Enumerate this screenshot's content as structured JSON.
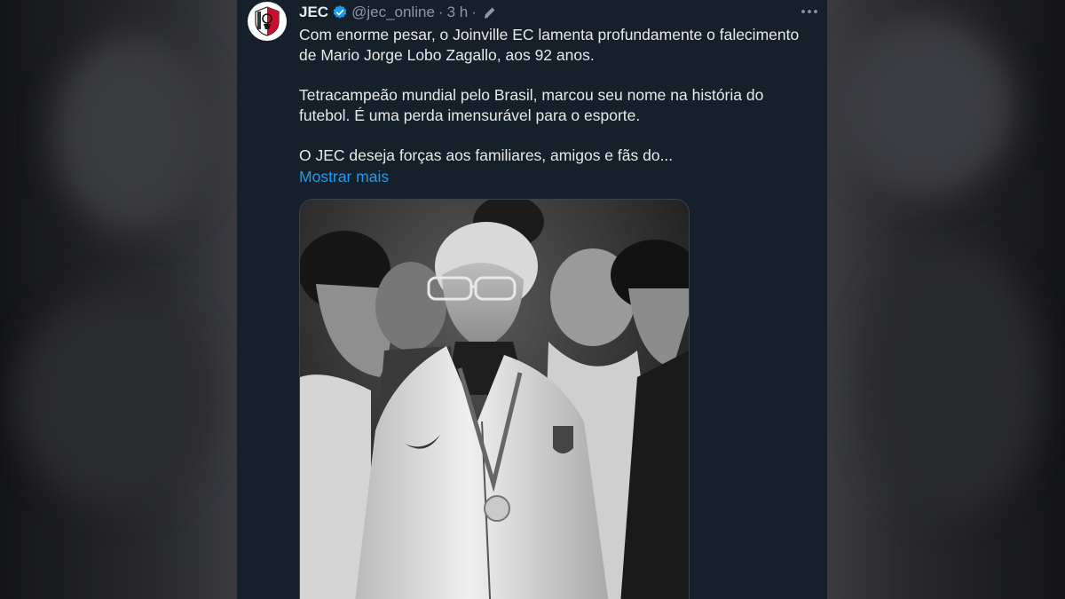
{
  "tweet": {
    "author_name": "JEC",
    "handle": "@jec_online",
    "separator": "·",
    "time": "3 h",
    "separator2": "·",
    "paragraphs": [
      "Com enorme pesar, o Joinville EC lamenta profundamente o falecimento de Mario Jorge Lobo Zagallo, aos 92 anos.",
      "Tetracampeão mundial pelo Brasil, marcou seu nome na história do futebol. É uma perda imensurável para o esporte.",
      "O JEC deseja forças aos familiares, amigos e fãs do..."
    ],
    "show_more": "Mostrar mais"
  },
  "colors": {
    "panel_bg": "#15202b",
    "text": "#e7e9ea",
    "muted": "#8b98a5",
    "link": "#1d9bf0",
    "verified": "#1d9bf0",
    "club_red": "#c8102e"
  },
  "icons": {
    "verified": "verified-badge-icon",
    "edited": "edit-pencil-icon",
    "more": "more-horizontal-icon"
  }
}
